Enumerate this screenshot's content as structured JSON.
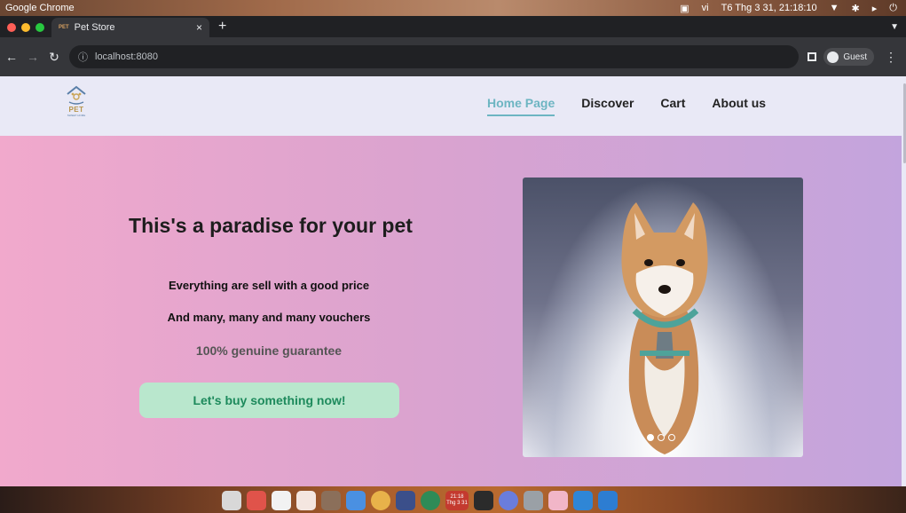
{
  "os": {
    "app_name": "Google Chrome",
    "language": "vi",
    "datetime": "T6 Thg 3 31, 21:18:10"
  },
  "browser": {
    "tab_title": "Pet Store",
    "tab_favicon_text": "PET",
    "url": "localhost:8080",
    "profile_label": "Guest"
  },
  "site": {
    "logo_word": "PET",
    "logo_sub": "SWEET HOME",
    "nav": [
      "Home Page",
      "Discover",
      "Cart",
      "About us"
    ],
    "active_nav": "Home Page"
  },
  "hero": {
    "headline": "This's a paradise for your pet",
    "line1": "Everything are sell with a good price",
    "line2": "And many, many and many vouchers",
    "line3": "100% genuine guarantee",
    "cta": "Let's buy something now!",
    "carousel_slide_count": 3,
    "carousel_active_index": 0
  },
  "dock": {
    "clock": "21:18",
    "date_badge": "Thg 3 31"
  },
  "colors": {
    "header_bg": "#e9e9f6",
    "nav_active": "#6db5c2",
    "hero_gradient_start": "#f1a9cc",
    "hero_gradient_end": "#c3a4dd",
    "cta_bg": "#b9e7cd",
    "cta_text": "#1d8a5c"
  }
}
